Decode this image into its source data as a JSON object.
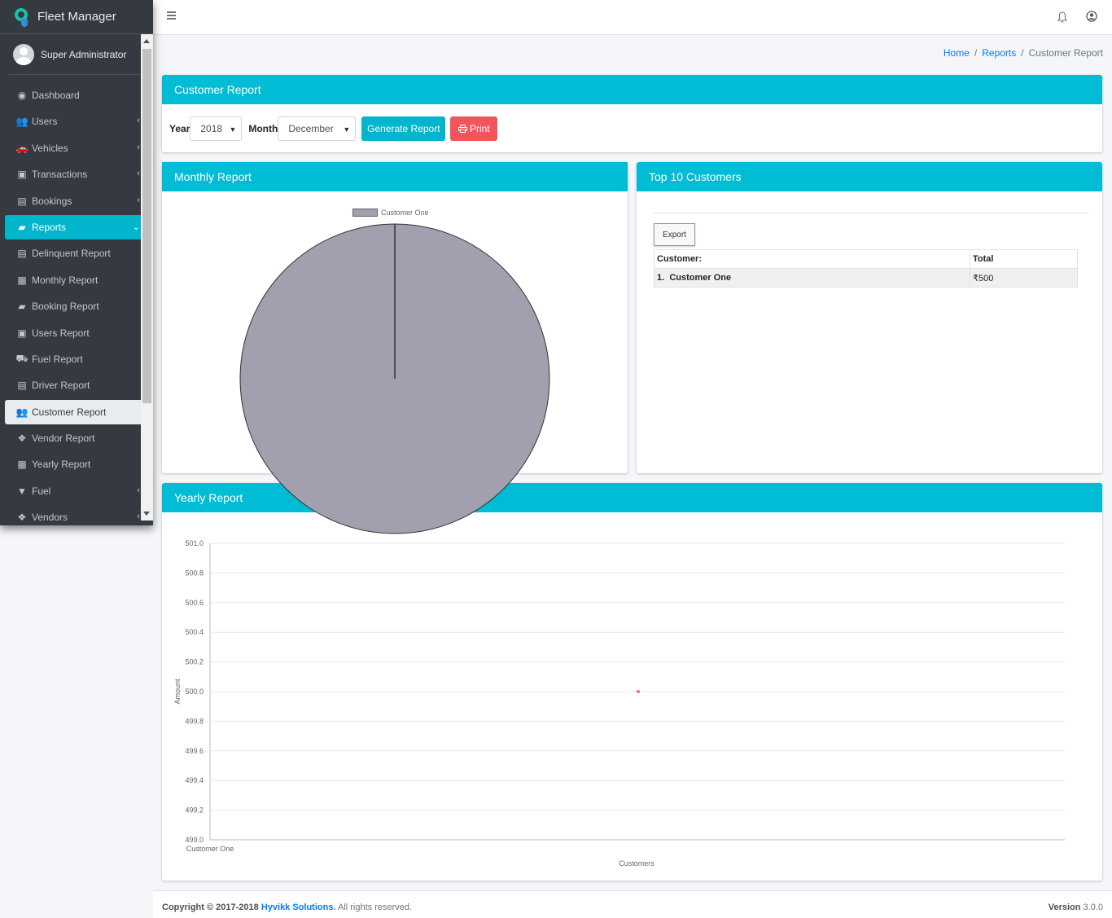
{
  "app": {
    "title": "Fleet Manager",
    "user": "Super Administrator"
  },
  "sidebar": {
    "items": [
      {
        "label": "Dashboard",
        "icon": "dashboard-icon",
        "glyph": "◉",
        "chevron": ""
      },
      {
        "label": "Users",
        "icon": "users-icon",
        "glyph": "👥",
        "chevron": "‹"
      },
      {
        "label": "Vehicles",
        "icon": "car-icon",
        "glyph": "🚗",
        "chevron": "‹"
      },
      {
        "label": "Transactions",
        "icon": "money-icon",
        "glyph": "▣",
        "chevron": "‹"
      },
      {
        "label": "Bookings",
        "icon": "address-card-icon",
        "glyph": "▤",
        "chevron": "‹"
      },
      {
        "label": "Reports",
        "icon": "book-icon",
        "glyph": "▰",
        "chevron": "⌄"
      },
      {
        "label": "Delinquent Report",
        "icon": "file-icon",
        "glyph": "▤",
        "chevron": ""
      },
      {
        "label": "Monthly Report",
        "icon": "calendar-icon",
        "glyph": "▦",
        "chevron": ""
      },
      {
        "label": "Booking Report",
        "icon": "book-icon",
        "glyph": "▰",
        "chevron": ""
      },
      {
        "label": "Users Report",
        "icon": "user-file-icon",
        "glyph": "▣",
        "chevron": ""
      },
      {
        "label": "Fuel Report",
        "icon": "truck-icon",
        "glyph": "⛟",
        "chevron": ""
      },
      {
        "label": "Driver Report",
        "icon": "id-card-icon",
        "glyph": "▤",
        "chevron": ""
      },
      {
        "label": "Customer Report",
        "icon": "users-icon",
        "glyph": "👥",
        "chevron": ""
      },
      {
        "label": "Vendor Report",
        "icon": "cubes-icon",
        "glyph": "❖",
        "chevron": ""
      },
      {
        "label": "Yearly Report",
        "icon": "calendar-icon",
        "glyph": "▦",
        "chevron": ""
      },
      {
        "label": "Fuel",
        "icon": "filter-icon",
        "glyph": "▼",
        "chevron": "‹"
      },
      {
        "label": "Vendors",
        "icon": "cubes-icon",
        "glyph": "❖",
        "chevron": "‹"
      }
    ]
  },
  "breadcrumb": {
    "home": "Home",
    "reports": "Reports",
    "current": "Customer Report",
    "sep": "/"
  },
  "customer_report": {
    "title": "Customer Report",
    "year_label": "Year",
    "year_value": "2018",
    "month_label": "Month",
    "month_value": "December",
    "generate_label": "Generate Report",
    "print_label": "Print"
  },
  "monthly_report": {
    "title": "Monthly Report",
    "legend": "Customer One"
  },
  "top_customers": {
    "title": "Top 10 Customers",
    "export_label": "Export",
    "headers": [
      "Customer:",
      "Total"
    ],
    "rows": [
      {
        "index": "1.",
        "name": "Customer One",
        "total": "₹500"
      }
    ]
  },
  "yearly_report": {
    "title": "Yearly Report"
  },
  "footer": {
    "copyright": "Copyright © 2017-2018",
    "company": "Hyvikk Solutions.",
    "rights": "All rights reserved.",
    "version_label": "Version",
    "version": "3.0.0"
  },
  "colors": {
    "accent": "#00bcd4",
    "print": "#f2545b",
    "pie": "#a29fae",
    "point": "#ff6384"
  },
  "chart_data": [
    {
      "type": "pie",
      "title": "",
      "categories": [
        "Customer One"
      ],
      "values": [
        500
      ],
      "legend": "top"
    },
    {
      "type": "scatter",
      "title": "",
      "xlabel": "Customers",
      "ylabel": "Amount",
      "categories": [
        "Customer One"
      ],
      "series": [
        {
          "values": [
            500.0
          ]
        }
      ],
      "ylim": [
        499.0,
        501.0
      ],
      "yticks": [
        "501.0",
        "500.8",
        "500.6",
        "500.4",
        "500.2",
        "500.0",
        "499.8",
        "499.6",
        "499.4",
        "499.2",
        "499.0"
      ],
      "grid": true
    }
  ]
}
